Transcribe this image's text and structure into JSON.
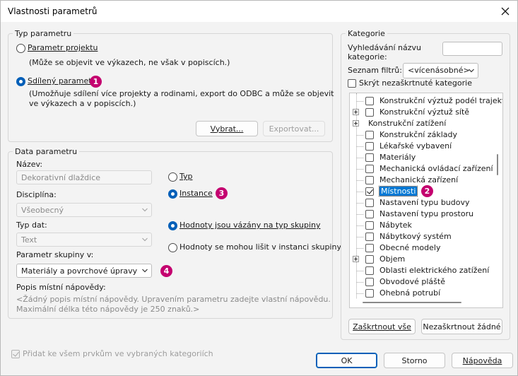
{
  "window": {
    "title": "Vlastnosti parametrů"
  },
  "type_group": {
    "legend": "Typ parametru",
    "project_label": "Parametr projektu",
    "project_desc": "(Může se objevit ve výkazech, ne však v popiscích.)",
    "shared_label": "Sdílený parametr",
    "shared_desc_1": "(Umožňuje sdílení více projekty a rodinami, export do ODBC a může se objevit",
    "shared_desc_2": "ve výkazech a v popiscích.)",
    "select_btn": "Vybrat...",
    "export_btn": "Exportovat...",
    "selected": "shared"
  },
  "data_group": {
    "legend": "Data parametru",
    "name_label": "Název:",
    "name_value": "Dekorativní dlaždice",
    "discipline_label": "Disciplína:",
    "discipline_value": "Všeobecný",
    "type_label": "Typ dat:",
    "type_value": "Text",
    "group_label": "Parametr skupiny v:",
    "group_value": "Materiály a povrchové úpravy",
    "tooltip_label": "Popis místní nápovědy:",
    "tooltip_text_1": "<Žádný popis místní nápovědy. Upravením parametru zadejte vlastní nápovědu.",
    "tooltip_text_2": "Maximální délka této nápovědy je 250 znaků.>",
    "radio_type": "Typ",
    "radio_instance": "Instance",
    "radio_aligned": "Hodnoty jsou vázány na typ skupiny",
    "radio_vary": "Hodnoty se mohou lišit v instanci skupiny"
  },
  "bottom": {
    "add_all_label": "Přidat ke všem prvkům ve vybraných kategoriích",
    "ok": "OK",
    "cancel": "Storno",
    "help": "Nápověda"
  },
  "category_group": {
    "legend": "Kategorie",
    "search_label_1": "Vyhledávání názvu",
    "search_label_2": "kategorie:",
    "search_value": "",
    "filter_label": "Seznam filtrů:",
    "filter_value": "<vícenásobné>",
    "hide_unchecked": "Skrýt nezaškrtnuté kategorie",
    "check_all": "Zaškrtnout vše",
    "uncheck_all": "Nezaškrtnout žádné",
    "items": [
      {
        "label": "Konstrukční výztuž podél trajekt...",
        "checked": false,
        "expander": false,
        "root": false
      },
      {
        "label": "Konstrukční výztuž sítě",
        "checked": false,
        "expander": true,
        "root": false
      },
      {
        "label": "Konstrukční zatížení",
        "checked": null,
        "expander": true,
        "root": true
      },
      {
        "label": "Konstrukční základy",
        "checked": false,
        "expander": false,
        "root": false
      },
      {
        "label": "Lékařské vybavení",
        "checked": false,
        "expander": false,
        "root": false
      },
      {
        "label": "Materiály",
        "checked": false,
        "expander": false,
        "root": false
      },
      {
        "label": "Mechanická ovládací zařízení",
        "checked": false,
        "expander": false,
        "root": false
      },
      {
        "label": "Mechanická zařízení",
        "checked": false,
        "expander": false,
        "root": false
      },
      {
        "label": "Místnosti",
        "checked": true,
        "expander": false,
        "root": false,
        "selected": true
      },
      {
        "label": "Nastavení typu budovy",
        "checked": false,
        "expander": false,
        "root": false
      },
      {
        "label": "Nastavení typu prostoru",
        "checked": false,
        "expander": false,
        "root": false
      },
      {
        "label": "Nábytek",
        "checked": false,
        "expander": false,
        "root": false
      },
      {
        "label": "Nábytkový systém",
        "checked": false,
        "expander": false,
        "root": false
      },
      {
        "label": "Obecné modely",
        "checked": false,
        "expander": false,
        "root": false
      },
      {
        "label": "Objem",
        "checked": false,
        "expander": true,
        "root": false
      },
      {
        "label": "Oblasti elektrického zatížení",
        "checked": false,
        "expander": false,
        "root": false
      },
      {
        "label": "Obvodové pláště",
        "checked": false,
        "expander": false,
        "root": false
      },
      {
        "label": "Ohebná potrubí",
        "checked": false,
        "expander": false,
        "root": false
      }
    ]
  },
  "badges": {
    "b1": "1",
    "b2": "2",
    "b3": "3",
    "b4": "4"
  },
  "colors": {
    "accent": "#005fb8",
    "badge": "#c4006f",
    "selection": "#0078d4"
  }
}
